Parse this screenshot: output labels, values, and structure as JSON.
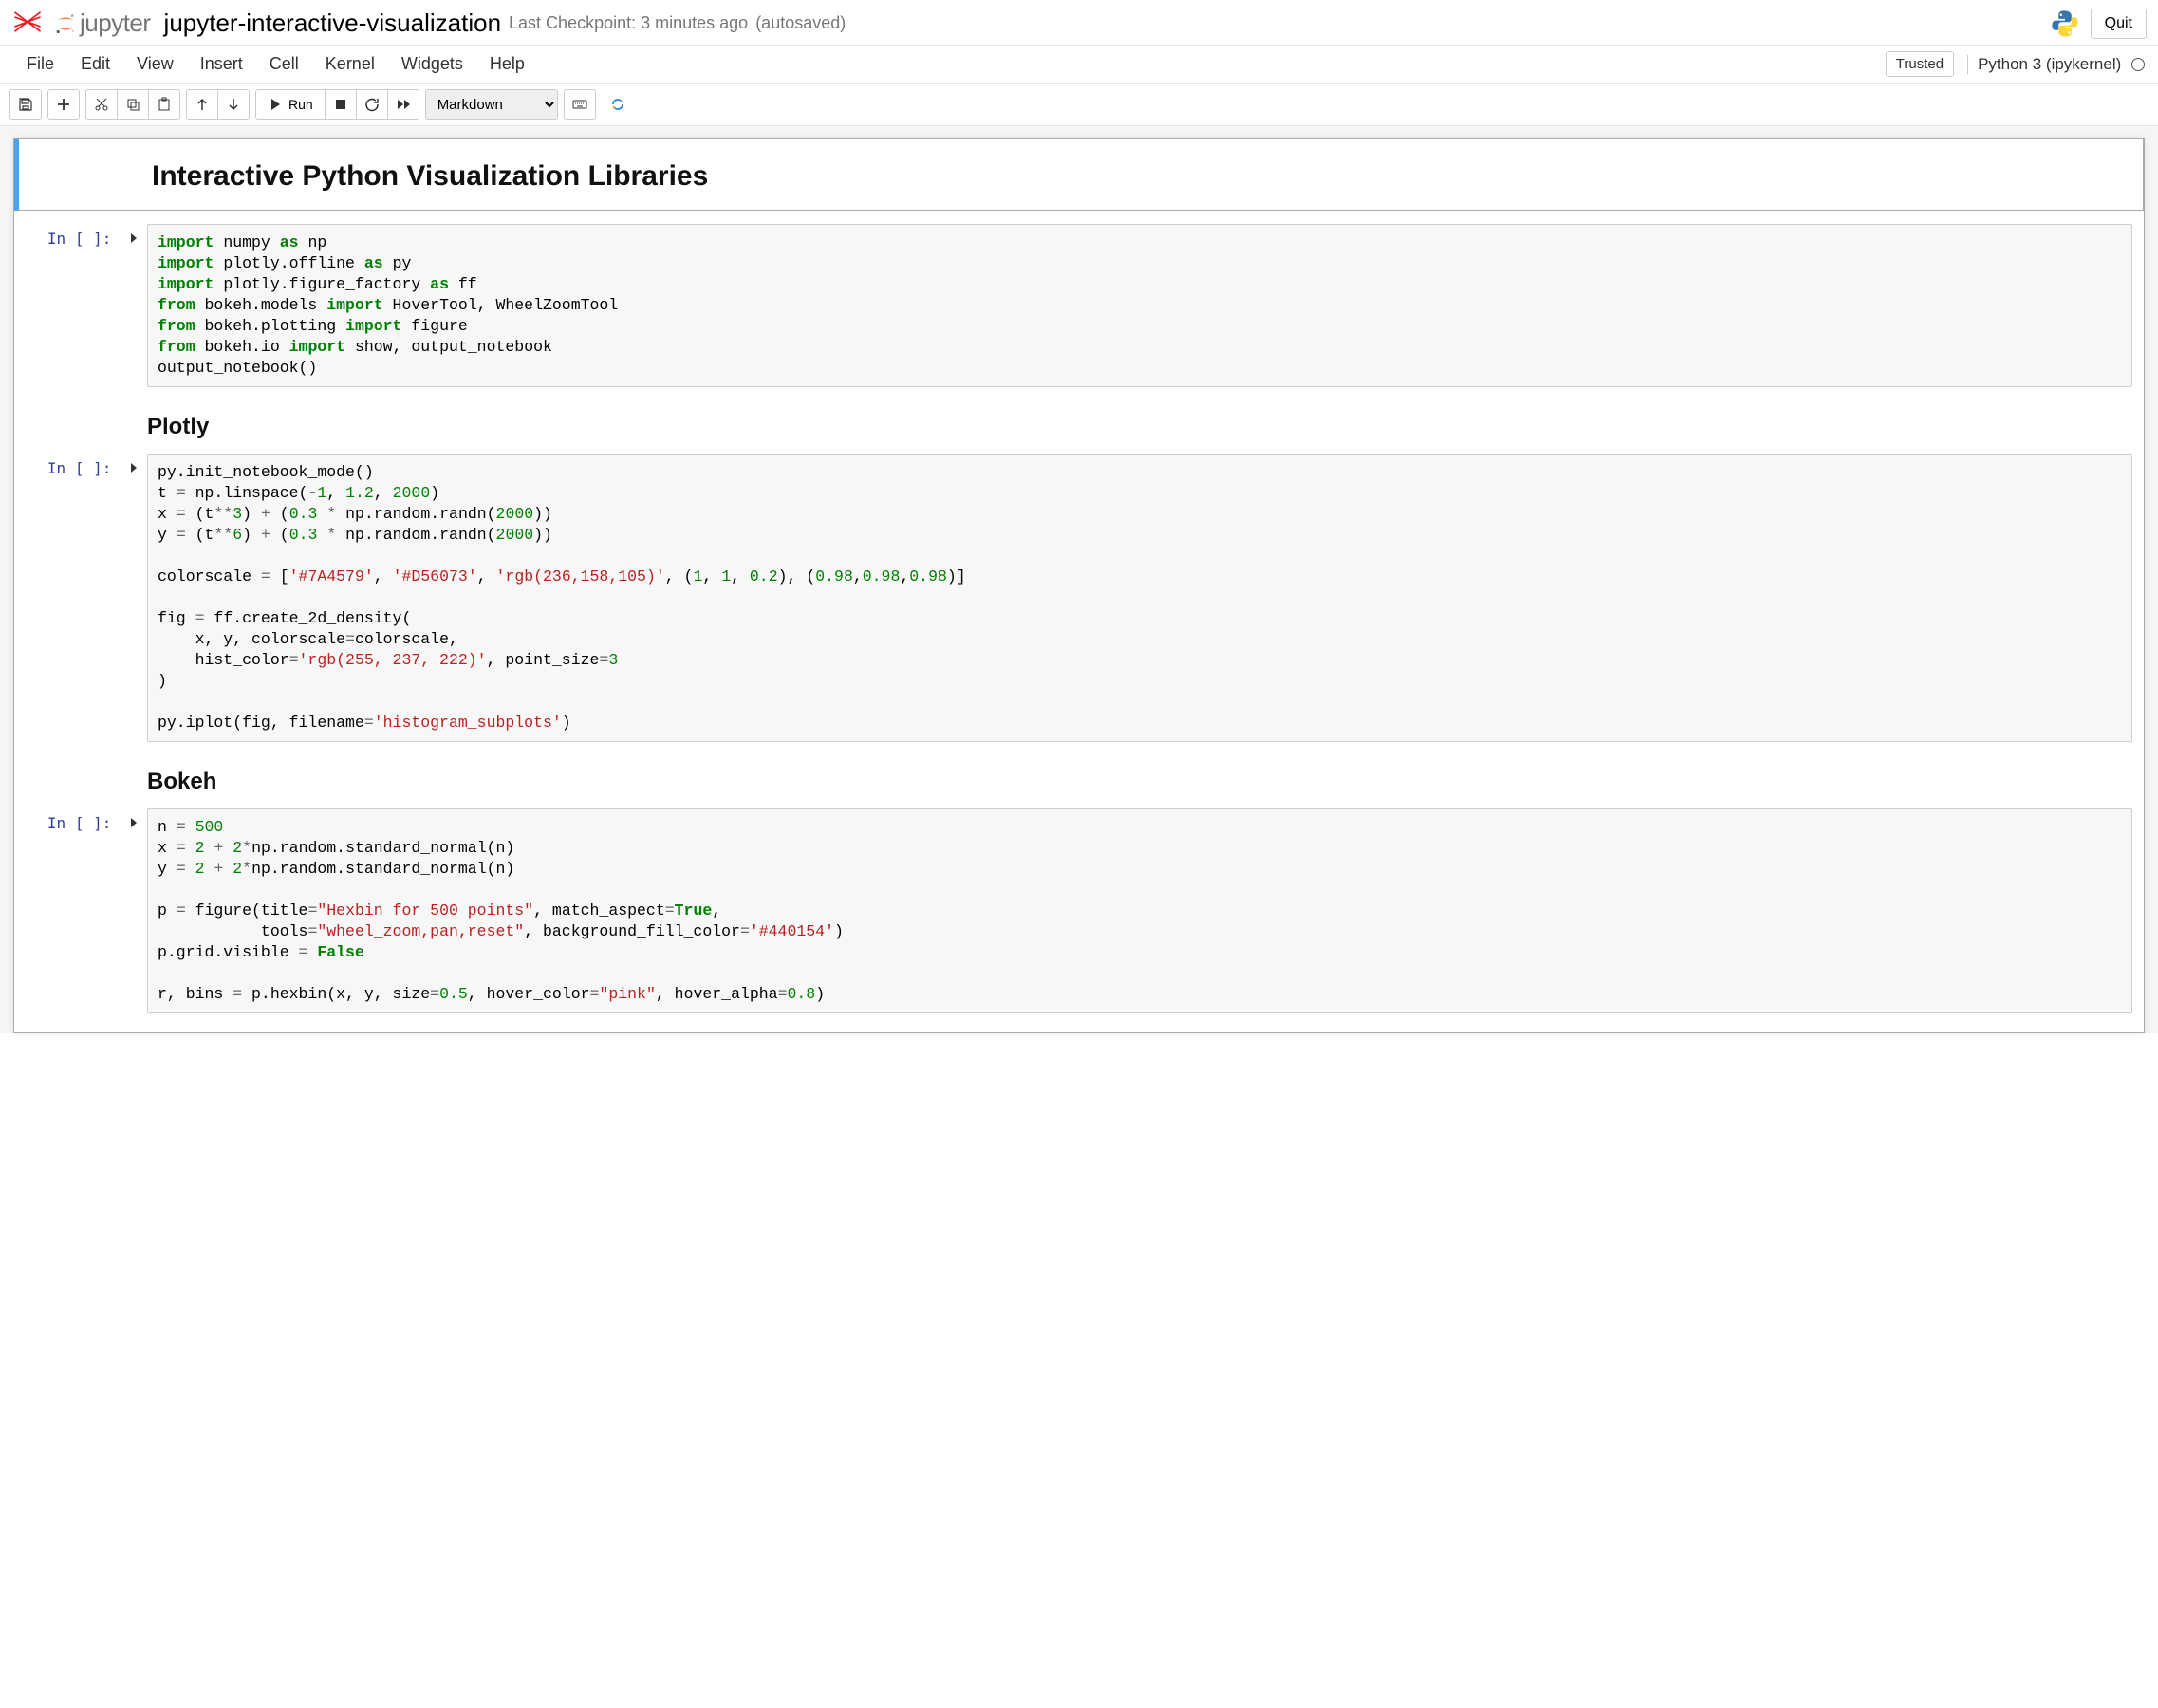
{
  "header": {
    "notebook_name": "jupyter-interactive-visualization",
    "checkpoint": "Last Checkpoint: 3 minutes ago",
    "autosaved": "(autosaved)",
    "quit": "Quit",
    "jupyter_word": "jupyter"
  },
  "menu": {
    "items": [
      "File",
      "Edit",
      "View",
      "Insert",
      "Cell",
      "Kernel",
      "Widgets",
      "Help"
    ],
    "trusted": "Trusted",
    "kernel": "Python 3 (ipykernel)"
  },
  "toolbar": {
    "run": "Run",
    "cell_type": "Markdown"
  },
  "cells": {
    "md1_title": "Interactive Python Visualization Libraries",
    "prompt_in": "In [ ]:",
    "code1_lines": [
      [
        "kw",
        "import"
      ],
      [
        "",
        " numpy "
      ],
      [
        "kw",
        "as"
      ],
      [
        "",
        " np"
      ],
      [
        "br"
      ],
      [
        "kw",
        "import"
      ],
      [
        "",
        " plotly.offline "
      ],
      [
        "kw",
        "as"
      ],
      [
        "",
        " py"
      ],
      [
        "br"
      ],
      [
        "kw",
        "import"
      ],
      [
        "",
        " plotly.figure_factory "
      ],
      [
        "kw",
        "as"
      ],
      [
        "",
        " ff"
      ],
      [
        "br"
      ],
      [
        "kw",
        "from"
      ],
      [
        "",
        " bokeh.models "
      ],
      [
        "kw",
        "import"
      ],
      [
        "",
        " HoverTool, WheelZoomTool"
      ],
      [
        "br"
      ],
      [
        "kw",
        "from"
      ],
      [
        "",
        " bokeh.plotting "
      ],
      [
        "kw",
        "import"
      ],
      [
        "",
        " figure"
      ],
      [
        "br"
      ],
      [
        "kw",
        "from"
      ],
      [
        "",
        " bokeh.io "
      ],
      [
        "kw",
        "import"
      ],
      [
        "",
        " show, output_notebook"
      ],
      [
        "br"
      ],
      [
        "",
        "output_notebook()"
      ]
    ],
    "md2_title": "Plotly",
    "code2_lines": [
      [
        "",
        "py.init_notebook_mode()"
      ],
      [
        "br"
      ],
      [
        "",
        "t "
      ],
      [
        "op",
        "="
      ],
      [
        "",
        " np.linspace("
      ],
      [
        "op",
        "-"
      ],
      [
        "num",
        "1"
      ],
      [
        "",
        ", "
      ],
      [
        "num",
        "1.2"
      ],
      [
        "",
        ", "
      ],
      [
        "num",
        "2000"
      ],
      [
        "",
        ")"
      ],
      [
        "br"
      ],
      [
        "",
        "x "
      ],
      [
        "op",
        "="
      ],
      [
        "",
        " (t"
      ],
      [
        "op",
        "**"
      ],
      [
        "num",
        "3"
      ],
      [
        "",
        ") "
      ],
      [
        "op",
        "+"
      ],
      [
        "",
        " ("
      ],
      [
        "num",
        "0.3"
      ],
      [
        "",
        " "
      ],
      [
        "op",
        "*"
      ],
      [
        "",
        " np.random.randn("
      ],
      [
        "num",
        "2000"
      ],
      [
        "",
        "))"
      ],
      [
        "br"
      ],
      [
        "",
        "y "
      ],
      [
        "op",
        "="
      ],
      [
        "",
        " (t"
      ],
      [
        "op",
        "**"
      ],
      [
        "num",
        "6"
      ],
      [
        "",
        ") "
      ],
      [
        "op",
        "+"
      ],
      [
        "",
        " ("
      ],
      [
        "num",
        "0.3"
      ],
      [
        "",
        " "
      ],
      [
        "op",
        "*"
      ],
      [
        "",
        " np.random.randn("
      ],
      [
        "num",
        "2000"
      ],
      [
        "",
        "))"
      ],
      [
        "br"
      ],
      [
        "br"
      ],
      [
        "",
        "colorscale "
      ],
      [
        "op",
        "="
      ],
      [
        "",
        " ["
      ],
      [
        "str",
        "'#7A4579'"
      ],
      [
        "",
        ", "
      ],
      [
        "str",
        "'#D56073'"
      ],
      [
        "",
        ", "
      ],
      [
        "str",
        "'rgb(236,158,105)'"
      ],
      [
        "",
        ", ("
      ],
      [
        "num",
        "1"
      ],
      [
        "",
        ", "
      ],
      [
        "num",
        "1"
      ],
      [
        "",
        ", "
      ],
      [
        "num",
        "0.2"
      ],
      [
        "",
        "), ("
      ],
      [
        "num",
        "0.98"
      ],
      [
        "",
        ","
      ],
      [
        "num",
        "0.98"
      ],
      [
        "",
        ","
      ],
      [
        "num",
        "0.98"
      ],
      [
        "",
        ")]"
      ],
      [
        "br"
      ],
      [
        "br"
      ],
      [
        "",
        "fig "
      ],
      [
        "op",
        "="
      ],
      [
        "",
        " ff.create_2d_density("
      ],
      [
        "br"
      ],
      [
        "",
        "    x, y, colorscale"
      ],
      [
        "op",
        "="
      ],
      [
        "",
        "colorscale,"
      ],
      [
        "br"
      ],
      [
        "",
        "    hist_color"
      ],
      [
        "op",
        "="
      ],
      [
        "str",
        "'rgb(255, 237, 222)'"
      ],
      [
        "",
        ", point_size"
      ],
      [
        "op",
        "="
      ],
      [
        "num",
        "3"
      ],
      [
        "br"
      ],
      [
        "",
        ")"
      ],
      [
        "br"
      ],
      [
        "br"
      ],
      [
        "",
        "py.iplot(fig, filename"
      ],
      [
        "op",
        "="
      ],
      [
        "str",
        "'histogram_subplots'"
      ],
      [
        "",
        ")"
      ]
    ],
    "md3_title": "Bokeh",
    "code3_lines": [
      [
        "",
        "n "
      ],
      [
        "op",
        "="
      ],
      [
        "",
        " "
      ],
      [
        "num",
        "500"
      ],
      [
        "br"
      ],
      [
        "",
        "x "
      ],
      [
        "op",
        "="
      ],
      [
        "",
        " "
      ],
      [
        "num",
        "2"
      ],
      [
        "",
        " "
      ],
      [
        "op",
        "+"
      ],
      [
        "",
        " "
      ],
      [
        "num",
        "2"
      ],
      [
        "op",
        "*"
      ],
      [
        "",
        "np.random.standard_normal(n)"
      ],
      [
        "br"
      ],
      [
        "",
        "y "
      ],
      [
        "op",
        "="
      ],
      [
        "",
        " "
      ],
      [
        "num",
        "2"
      ],
      [
        "",
        " "
      ],
      [
        "op",
        "+"
      ],
      [
        "",
        " "
      ],
      [
        "num",
        "2"
      ],
      [
        "op",
        "*"
      ],
      [
        "",
        "np.random.standard_normal(n)"
      ],
      [
        "br"
      ],
      [
        "br"
      ],
      [
        "",
        "p "
      ],
      [
        "op",
        "="
      ],
      [
        "",
        " figure(title"
      ],
      [
        "op",
        "="
      ],
      [
        "str",
        "\"Hexbin for 500 points\""
      ],
      [
        "",
        ", match_aspect"
      ],
      [
        "op",
        "="
      ],
      [
        "bool",
        "True"
      ],
      [
        "",
        ","
      ],
      [
        "br"
      ],
      [
        "",
        "           tools"
      ],
      [
        "op",
        "="
      ],
      [
        "str",
        "\"wheel_zoom,pan,reset\""
      ],
      [
        "",
        ", background_fill_color"
      ],
      [
        "op",
        "="
      ],
      [
        "str",
        "'#440154'"
      ],
      [
        "",
        ")"
      ],
      [
        "br"
      ],
      [
        "",
        "p.grid.visible "
      ],
      [
        "op",
        "="
      ],
      [
        "",
        " "
      ],
      [
        "bool",
        "False"
      ],
      [
        "br"
      ],
      [
        "br"
      ],
      [
        "",
        "r, bins "
      ],
      [
        "op",
        "="
      ],
      [
        "",
        " p.hexbin(x, y, size"
      ],
      [
        "op",
        "="
      ],
      [
        "num",
        "0.5"
      ],
      [
        "",
        ", hover_color"
      ],
      [
        "op",
        "="
      ],
      [
        "str",
        "\"pink\""
      ],
      [
        "",
        ", hover_alpha"
      ],
      [
        "op",
        "="
      ],
      [
        "num",
        "0.8"
      ],
      [
        "",
        ")"
      ]
    ]
  }
}
